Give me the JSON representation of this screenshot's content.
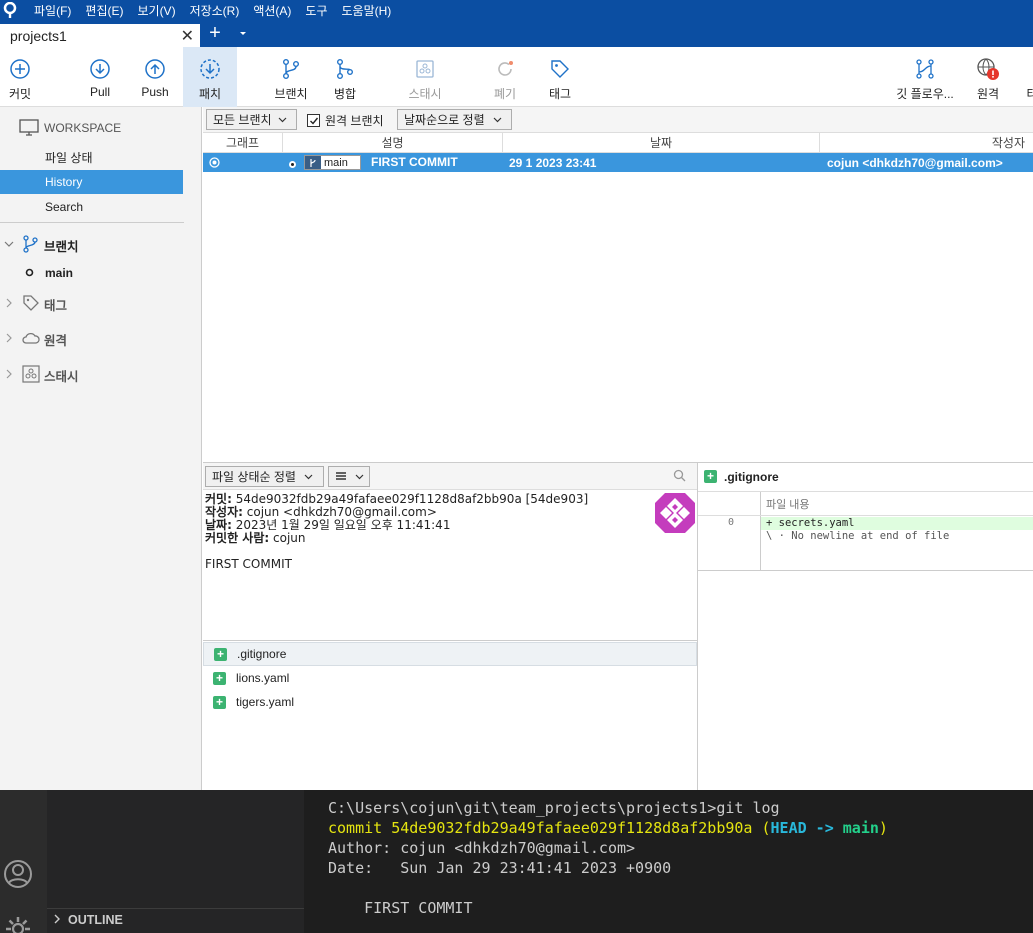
{
  "menu": [
    "파일(F)",
    "편집(E)",
    "보기(V)",
    "저장소(R)",
    "액션(A)",
    "도구",
    "도움말(H)"
  ],
  "tab": {
    "title": "projects1",
    "close": "✕",
    "new": "+"
  },
  "toolbar": {
    "commit": "커밋",
    "pull": "Pull",
    "push": "Push",
    "fetch": "패치",
    "branch": "브랜치",
    "merge": "병합",
    "stash": "스태시",
    "discard": "폐기",
    "tag": "태그",
    "gitflow": "깃 플로우...",
    "remote": "원격",
    "more": "터"
  },
  "sidebar": {
    "workspace": "WORKSPACE",
    "file_status": "파일 상태",
    "history": "History",
    "search": "Search",
    "branches": "브랜치",
    "branch_main": "main",
    "tags": "태그",
    "remotes": "원격",
    "stashes": "스태시"
  },
  "filters": {
    "branches": "모든 브랜치",
    "remote_branch": "원격 브랜치",
    "sort": "날짜순으로 정렬"
  },
  "columns": {
    "graph": "그래프",
    "description": "설명",
    "date": "날짜",
    "author": "작성자"
  },
  "commit": {
    "branch_label": "main",
    "message": "FIRST COMMIT",
    "date": "29 1 2023 23:41",
    "author": "cojun <dhkdzh70@gmail.com>"
  },
  "detail": {
    "sort_label": "파일 상태순 정렬",
    "commit_label": "커밋:",
    "commit_value": "54de9032fdb29a49fafaee029f1128d8af2bb90a [54de903]",
    "author_label": "작성자:",
    "author_value": "cojun <dhkdzh70@gmail.com>",
    "date_label": "날짜:",
    "date_value": "2023년 1월 29일 일요일 오후 11:41:41",
    "committer_label": "커밋한 사람:",
    "committer_value": "cojun",
    "message": "FIRST COMMIT"
  },
  "files": [
    ".gitignore",
    "lions.yaml",
    "tigers.yaml"
  ],
  "diff": {
    "file": ".gitignore",
    "header": "파일 내용",
    "line_no": "0",
    "line1": "+ secrets.yaml",
    "line2": "\\ · No newline at end of file"
  },
  "explorer": {
    "outline": "OUTLINE"
  },
  "terminal": {
    "prompt": "C:\\Users\\cojun\\git\\team_projects\\projects1>git log",
    "commit_word": "commit ",
    "commit_hash": "54de9032fdb29a49fafaee029f1128d8af2bb90a ",
    "paren_open": "(",
    "head": "HEAD -> ",
    "main": "main",
    "paren_close": ")",
    "author": "Author: cojun <dhkdzh70@gmail.com>",
    "date": "Date:   Sun Jan 29 23:41:41 2023 +0900",
    "message": "    FIRST COMMIT"
  },
  "colors": {
    "accent": "#3a96dd",
    "menubar": "#0b4ea2",
    "added": "#3cb371",
    "terminal_yellow": "#e5e510",
    "terminal_cyan": "#29b8db",
    "terminal_green": "#23d18b"
  }
}
